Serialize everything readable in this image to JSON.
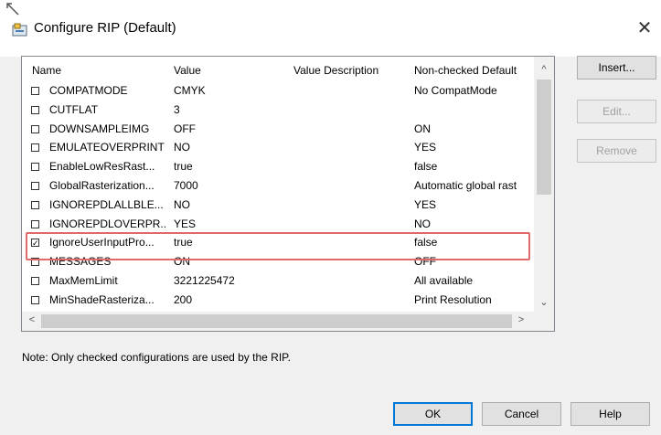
{
  "window": {
    "title": "Configure RIP (Default)",
    "close_glyph": "✕"
  },
  "columns": [
    "Name",
    "Value",
    "Value Description",
    "Non-checked Default"
  ],
  "rows": [
    {
      "checked": false,
      "name": "COMPATMODE",
      "value": "CMYK",
      "description": "",
      "default": "No CompatMode"
    },
    {
      "checked": false,
      "name": "CUTFLAT",
      "value": "3",
      "description": "",
      "default": ""
    },
    {
      "checked": false,
      "name": "DOWNSAMPLEIMG",
      "value": "OFF",
      "description": "",
      "default": "ON"
    },
    {
      "checked": false,
      "name": "EMULATEOVERPRINT",
      "value": "NO",
      "description": "",
      "default": "YES"
    },
    {
      "checked": false,
      "name": "EnableLowResRast...",
      "value": "true",
      "description": "",
      "default": "false"
    },
    {
      "checked": false,
      "name": "GlobalRasterization...",
      "value": "7000",
      "description": "",
      "default": "Automatic global rast"
    },
    {
      "checked": false,
      "name": "IGNOREPDLALLBLE...",
      "value": "NO",
      "description": "",
      "default": "YES"
    },
    {
      "checked": false,
      "name": "IGNOREPDLOVERPR...",
      "value": "YES",
      "description": "",
      "default": "NO"
    },
    {
      "checked": true,
      "name": "IgnoreUserInputPro...",
      "value": "true",
      "description": "",
      "default": "false"
    },
    {
      "checked": false,
      "name": "MESSAGES",
      "value": "ON",
      "description": "",
      "default": "OFF"
    },
    {
      "checked": false,
      "name": "MaxMemLimit",
      "value": "3221225472",
      "description": "",
      "default": "All available"
    },
    {
      "checked": false,
      "name": "MinShadeRasteriza...",
      "value": "200",
      "description": "",
      "default": "Print Resolution"
    }
  ],
  "buttons": {
    "insert": "Insert...",
    "edit": "Edit...",
    "remove": "Remove",
    "ok": "OK",
    "cancel": "Cancel",
    "help": "Help"
  },
  "note": "Note: Only checked configurations are used by the RIP.",
  "scroll": {
    "up": "^",
    "down": "⌄",
    "left": "<",
    "right": ">"
  },
  "colors": {
    "highlight": "#e06a6a",
    "accent": "#0078d7"
  }
}
